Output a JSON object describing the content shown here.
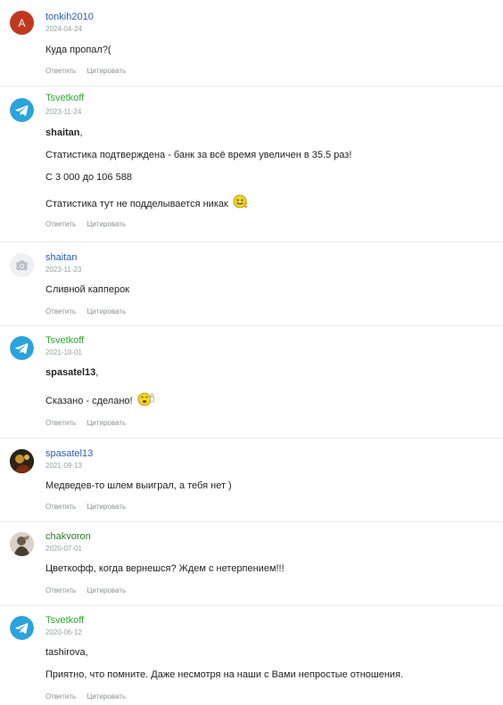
{
  "actions": {
    "reply": "Ответить",
    "quote": "Цитировать"
  },
  "comments": [
    {
      "author": "tonkih2010",
      "author_color": "#2a5db0",
      "date": "2024-04-24",
      "avatar_letter": "A",
      "avatar_color": "#c0391f",
      "text1": "Куда пропал?("
    },
    {
      "author": "Tsvetkoff",
      "author_color": "#2fa82f",
      "date": "2023-11-24",
      "avatar_icon": "telegram-icon",
      "mention": "shaitan",
      "mention_suffix": ",",
      "text1": "Статистика подтверждена - банк за всё время увеличен в 35.5 раз!",
      "text2": "С 3 000 до 106 588",
      "text3": "Статистика тут не подделывается никак"
    },
    {
      "author": "shaitan",
      "author_color": "#2a5db0",
      "date": "2023-11-23",
      "avatar_icon": "camera-icon",
      "text1": "Сливной капперок"
    },
    {
      "author": "Tsvetkoff",
      "author_color": "#2fa82f",
      "date": "2021-10-01",
      "avatar_icon": "telegram-icon",
      "mention": "spasatel13",
      "mention_suffix": ",",
      "text1": "Сказано - сделано!"
    },
    {
      "author": "spasatel13",
      "author_color": "#2a5db0",
      "date": "2021-09-13",
      "avatar_icon": "photo-avatar",
      "text1": "Медведев-то шлем выиграл, а тебя нет )"
    },
    {
      "author": "chakvoron",
      "author_color": "#2a7a2a",
      "date": "2020-07-01",
      "avatar_icon": "photo-avatar",
      "text1": "Цветкофф, когда вернешся? Ждем с нетерпением!!!"
    },
    {
      "author": "Tsvetkoff",
      "author_color": "#2fa82f",
      "date": "2020-06-12",
      "avatar_icon": "telegram-icon",
      "mention": "tashirova,",
      "text1": "Приятно, что помните. Даже несмотря на наши с Вами непростые отношения."
    }
  ]
}
